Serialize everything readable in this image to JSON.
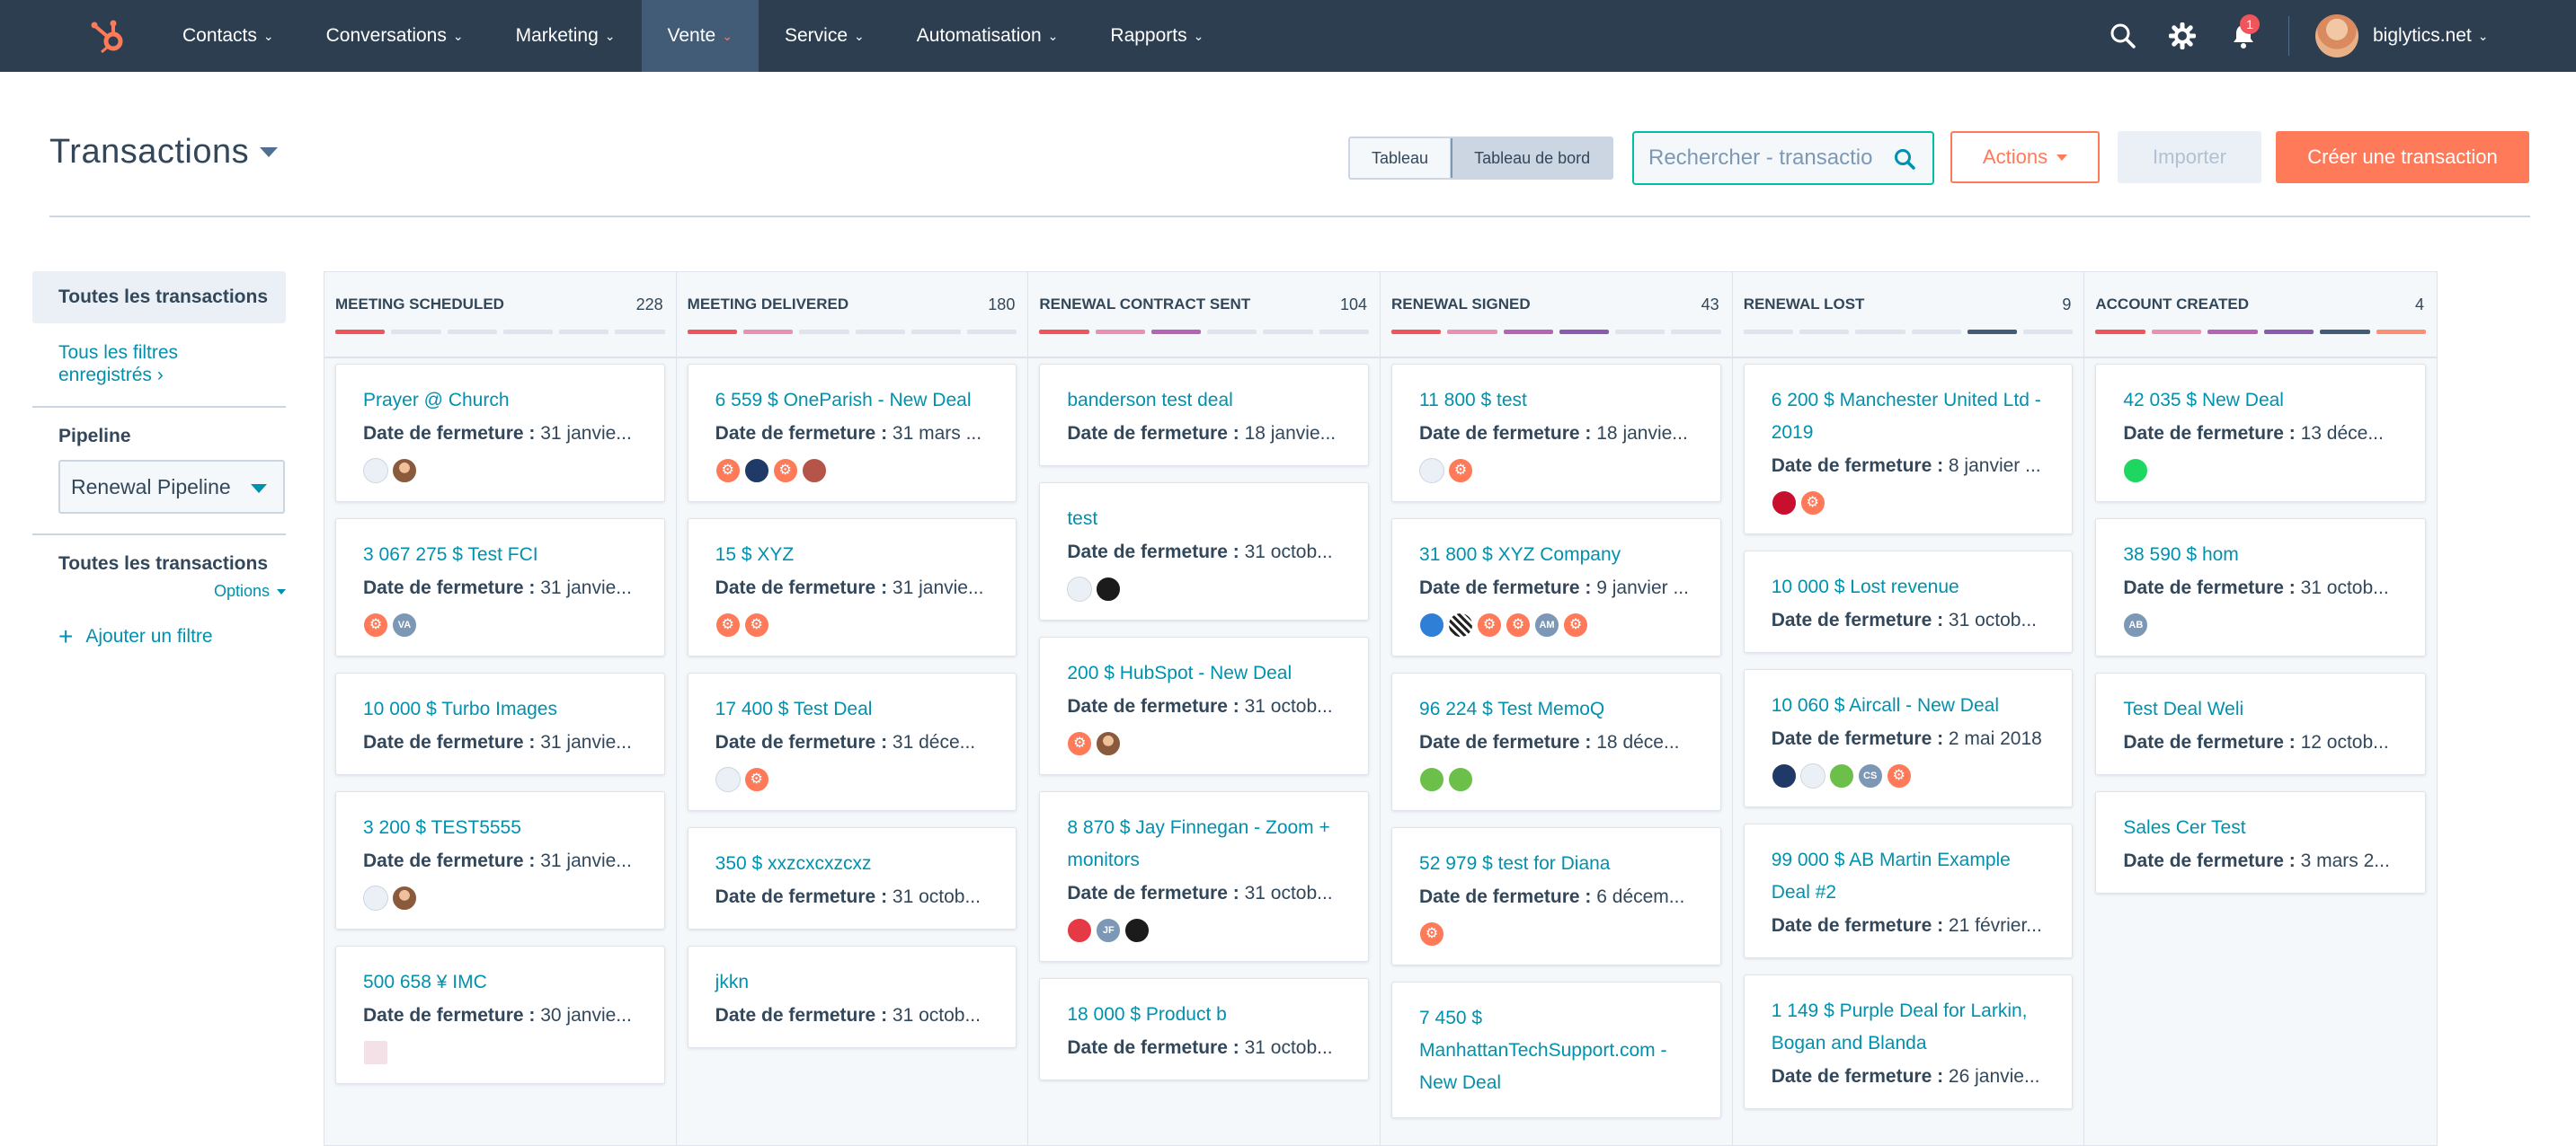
{
  "nav": {
    "items": [
      {
        "label": "Contacts",
        "active": false
      },
      {
        "label": "Conversations",
        "active": false
      },
      {
        "label": "Marketing",
        "active": false
      },
      {
        "label": "Vente",
        "active": true
      },
      {
        "label": "Service",
        "active": false
      },
      {
        "label": "Automatisation",
        "active": false
      },
      {
        "label": "Rapports",
        "active": false
      }
    ],
    "notification_count": "1",
    "account": "biglytics.net",
    "accent_color": "#ff7a59",
    "bg_color": "#2d3e50"
  },
  "header": {
    "title": "Transactions",
    "view_table": "Tableau",
    "view_board": "Tableau de bord",
    "search_placeholder": "Rechercher - transactio",
    "actions": "Actions",
    "import": "Importer",
    "create": "Créer une transaction"
  },
  "sidebar": {
    "all_deals": "Toutes les transactions",
    "saved_filters": "Tous les filtres enregistrés",
    "saved_filters_chevron": "›",
    "pipeline_label": "Pipeline",
    "pipeline_value": "Renewal Pipeline",
    "all_deals_2": "Toutes les transactions",
    "options": "Options",
    "add_filter": "Ajouter un filtre"
  },
  "date_prefix": "Date de fermeture :",
  "columns": [
    {
      "name": "MEETING SCHEDULED",
      "count": "228",
      "bars": [
        "#f2545b",
        "#dfe3eb",
        "#dfe3eb",
        "#dfe3eb",
        "#dfe3eb",
        "#dfe3eb"
      ],
      "cards": [
        {
          "title": "Prayer @ Church",
          "date": "31 janvie...",
          "avatars": [
            "grey",
            "person"
          ]
        },
        {
          "title": "3 067 275 $ Test FCI",
          "date": "31 janvie...",
          "avatars": [
            "hs",
            "initials:VA"
          ]
        },
        {
          "title": "10 000 $ Turbo Images",
          "date": "31 janvie...",
          "avatars": []
        },
        {
          "title": "3 200 $ TEST5555",
          "date": "31 janvie...",
          "avatars": [
            "grey",
            "person"
          ]
        },
        {
          "title": "500 658 ¥ IMC",
          "date": "30 janvie...",
          "avatars": [
            "sq"
          ]
        }
      ]
    },
    {
      "name": "MEETING DELIVERED",
      "count": "180",
      "bars": [
        "#f2545b",
        "#ea90b1",
        "#dfe3eb",
        "#dfe3eb",
        "#dfe3eb",
        "#dfe3eb"
      ],
      "cards": [
        {
          "title": "6 559 $ OneParish - New Deal",
          "date": "31 mars ...",
          "avatars": [
            "hs",
            "navy",
            "hs",
            "brown"
          ]
        },
        {
          "title": "15 $ XYZ",
          "date": "31 janvie...",
          "avatars": [
            "hs",
            "hs"
          ]
        },
        {
          "title": "17 400 $ Test Deal",
          "date": "31 déce...",
          "avatars": [
            "grey",
            "hs"
          ]
        },
        {
          "title": "350 $ xxzcxcxzcxz",
          "date": "31 octob...",
          "avatars": []
        },
        {
          "title": "jkkn",
          "date": "31 octob...",
          "avatars": []
        }
      ]
    },
    {
      "name": "RENEWAL CONTRACT SENT",
      "count": "104",
      "bars": [
        "#f2545b",
        "#ea90b1",
        "#b565b3",
        "#dfe3eb",
        "#dfe3eb",
        "#dfe3eb"
      ],
      "cards": [
        {
          "title": "banderson test deal",
          "date": "18 janvie...",
          "avatars": []
        },
        {
          "title": "test",
          "date": "31 octob...",
          "avatars": [
            "grey",
            "dark"
          ]
        },
        {
          "title": "200 $ HubSpot - New Deal",
          "date": "31 octob...",
          "avatars": [
            "hs",
            "person"
          ]
        },
        {
          "title": "8 870 $ Jay Finnegan - Zoom + monitors",
          "date": "31 octob...",
          "avatars": [
            "red",
            "initials:JF",
            "dark"
          ]
        },
        {
          "title": "18 000 $ Product b",
          "date": "31 octob...",
          "avatars": []
        }
      ]
    },
    {
      "name": "RENEWAL SIGNED",
      "count": "43",
      "bars": [
        "#f2545b",
        "#ea90b1",
        "#b565b3",
        "#8a5bb0",
        "#dfe3eb",
        "#dfe3eb"
      ],
      "cards": [
        {
          "title": "11 800 $ test",
          "date": "18 janvie...",
          "avatars": [
            "grey",
            "hs"
          ]
        },
        {
          "title": "31 800 $ XYZ Company",
          "date": "9 janvier ...",
          "avatars": [
            "blue",
            "stripe",
            "hs",
            "hs",
            "initials:AM",
            "hs"
          ]
        },
        {
          "title": "96 224 $ Test MemoQ",
          "date": "18 déce...",
          "avatars": [
            "green",
            "green"
          ]
        },
        {
          "title": "52 979 $ test for Diana",
          "date": "6 décem...",
          "avatars": [
            "hs"
          ]
        },
        {
          "title": "7 450 $ ManhattanTechSupport.com - New Deal",
          "date": "",
          "avatars": []
        }
      ]
    },
    {
      "name": "RENEWAL LOST",
      "count": "9",
      "bars": [
        "#dfe3eb",
        "#dfe3eb",
        "#dfe3eb",
        "#dfe3eb",
        "#425b76",
        "#dfe3eb"
      ],
      "cards": [
        {
          "title": "6 200 $ Manchester United Ltd - 2019",
          "date": "8 janvier ...",
          "avatars": [
            "mu",
            "hs"
          ]
        },
        {
          "title": "10 000 $ Lost revenue",
          "date": "31 octob...",
          "avatars": []
        },
        {
          "title": "10 060 $ Aircall - New Deal",
          "date": "2 mai 2018",
          "avatars": [
            "navy",
            "grey",
            "green",
            "initials:CS",
            "hs"
          ]
        },
        {
          "title": "99 000 $ AB Martin Example Deal #2",
          "date": "21 février...",
          "avatars": []
        },
        {
          "title": "1 149 $ Purple Deal for Larkin, Bogan and Blanda",
          "date": "26 janvie...",
          "avatars": []
        }
      ]
    },
    {
      "name": "ACCOUNT CREATED",
      "count": "4",
      "bars": [
        "#f2545b",
        "#ea90b1",
        "#b565b3",
        "#8a5bb0",
        "#425b76",
        "#ff8f73"
      ],
      "cards": [
        {
          "title": "42 035 $ New Deal",
          "date": "13 déce...",
          "avatars": [
            "spot"
          ]
        },
        {
          "title": "38 590 $ hom",
          "date": "31 octob...",
          "avatars": [
            "initials:AB"
          ]
        },
        {
          "title": "Test Deal Weli",
          "date": "12 octob...",
          "avatars": []
        },
        {
          "title": "Sales Cer Test",
          "date": "3 mars 2...",
          "avatars": []
        }
      ]
    }
  ]
}
